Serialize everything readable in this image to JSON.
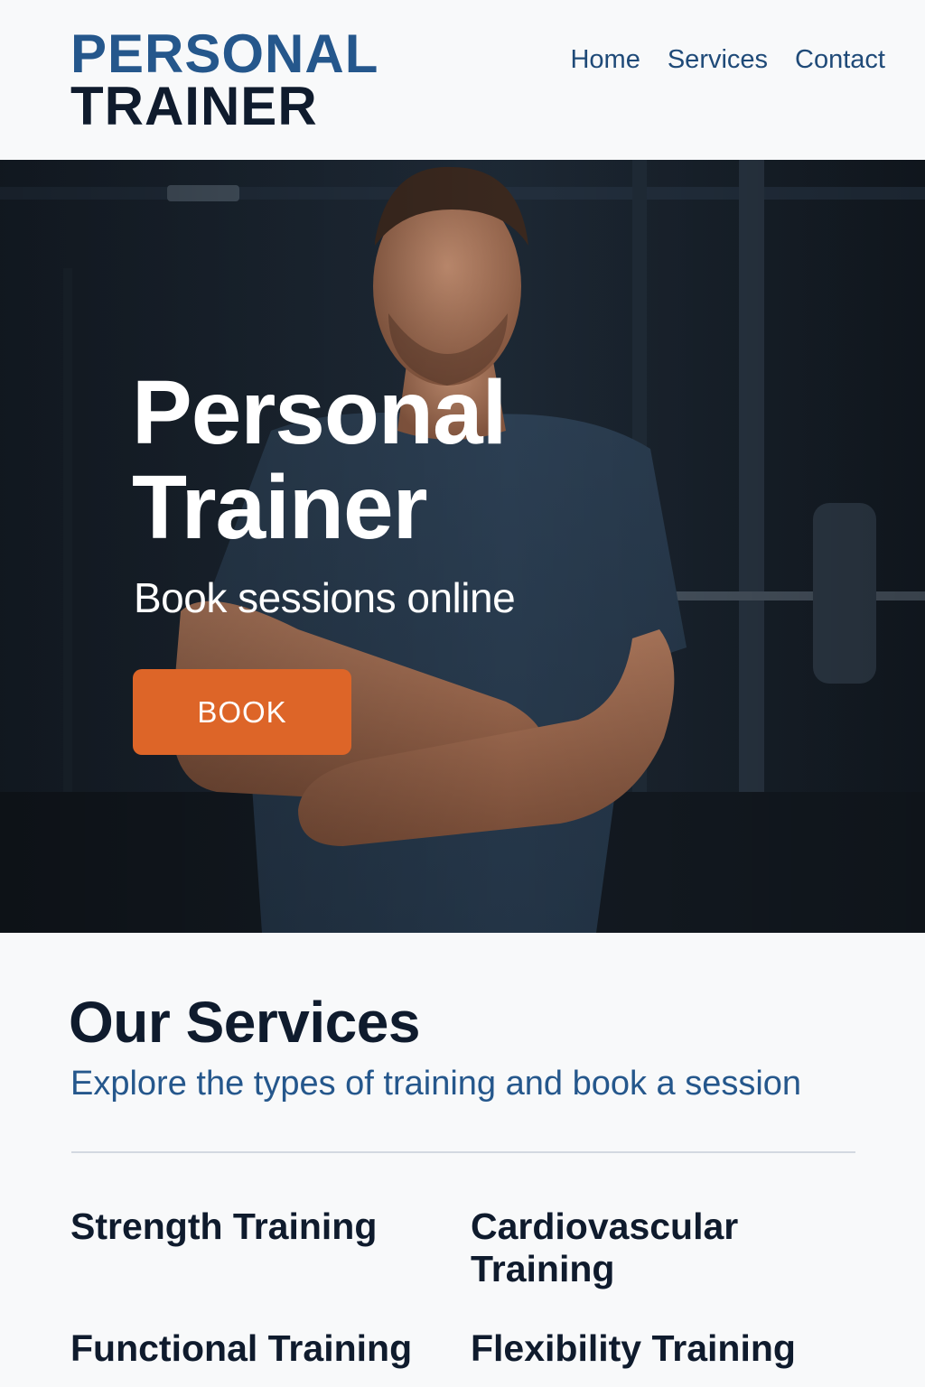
{
  "header": {
    "logo_line1": "PERSONAL",
    "logo_line2": "TRAINER",
    "nav": [
      {
        "label": "Home"
      },
      {
        "label": "Services"
      },
      {
        "label": "Contact"
      }
    ]
  },
  "hero": {
    "title_line1": "Personal",
    "title_line2": "Trainer",
    "subtitle": "Book sessions online",
    "button_label": "BOOK"
  },
  "services": {
    "title": "Our Services",
    "subtitle": "Explore the types of training and book a session",
    "items": [
      {
        "label": "Strength Training"
      },
      {
        "label": "Cardiovascular Training"
      },
      {
        "label": "Functional Training"
      },
      {
        "label": "Flexibility Training"
      }
    ]
  },
  "colors": {
    "brand_blue": "#25578c",
    "navy": "#0f1b2d",
    "accent_orange": "#dd6528",
    "background": "#f8f9fa"
  }
}
